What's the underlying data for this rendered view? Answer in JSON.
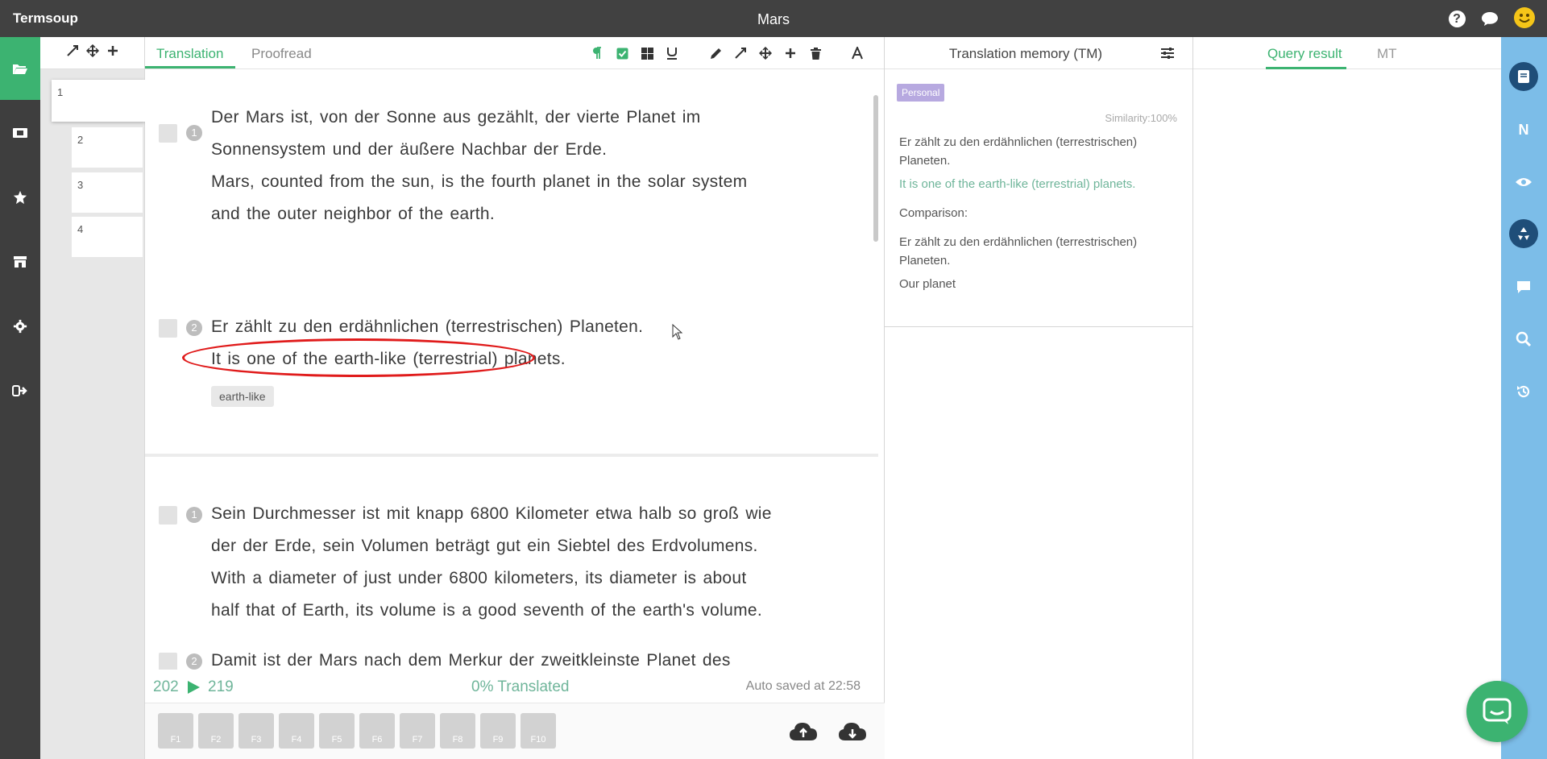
{
  "app": {
    "brand": "Termsoup",
    "document_title": "Mars"
  },
  "thumbnails": {
    "pages": [
      "1",
      "2",
      "3",
      "4"
    ]
  },
  "editor": {
    "tabs": [
      "Translation",
      "Proofread"
    ],
    "segments": [
      {
        "number": "1",
        "source": [
          "Der Mars ist, von der Sonne aus gezählt, der vierte Planet im",
          "Sonnensystem und der äußere Nachbar der Erde."
        ],
        "target": [
          "Mars, counted from the sun, is the fourth planet in the solar system",
          "and the outer neighbor of the earth."
        ]
      },
      {
        "number": "2",
        "source": [
          "Er zählt zu den erdähnlichen (terrestrischen) Planeten."
        ],
        "target": [
          "It is one of the earth-like (terrestrial) planets."
        ],
        "term": "earth-like"
      },
      {
        "number": "1",
        "source": [
          "Sein Durchmesser ist mit knapp 6800 Kilometer etwa halb so groß wie",
          "der der Erde, sein Volumen beträgt gut ein Siebtel des Erdvolumens."
        ],
        "target": [
          "With a diameter of just under 6800 kilometers, its diameter is about",
          "half that of Earth, its volume is a good seventh of the earth's volume."
        ]
      },
      {
        "number": "2",
        "source": [
          "Damit ist der Mars nach dem Merkur der zweitkleinste Planet des"
        ]
      }
    ],
    "status": {
      "current": "202",
      "total": "219",
      "translated": "0% Translated",
      "saved": "Auto saved at 22:58"
    },
    "function_keys": [
      "F1",
      "F2",
      "F3",
      "F4",
      "F5",
      "F6",
      "F7",
      "F8",
      "F9",
      "F10"
    ]
  },
  "tm": {
    "title": "Translation memory (TM)",
    "badge": "Personal",
    "similarity": "Similarity:100%",
    "source": "Er zählt zu den erdähnlichen (terrestrischen) Planeten.",
    "target": "It is one of the earth-like (terrestrial) planets.",
    "comparison_label": "Comparison:",
    "comparison_text": "Er zählt zu den erdähnlichen (terrestrischen) Planeten.",
    "note": "Our planet"
  },
  "query": {
    "tabs": [
      "Query result",
      "MT"
    ]
  },
  "colors": {
    "accent": "#3cb371",
    "sidebar": "#3e3e3e",
    "rightbar": "#7cbde8",
    "highlight": "#e01b1b"
  }
}
